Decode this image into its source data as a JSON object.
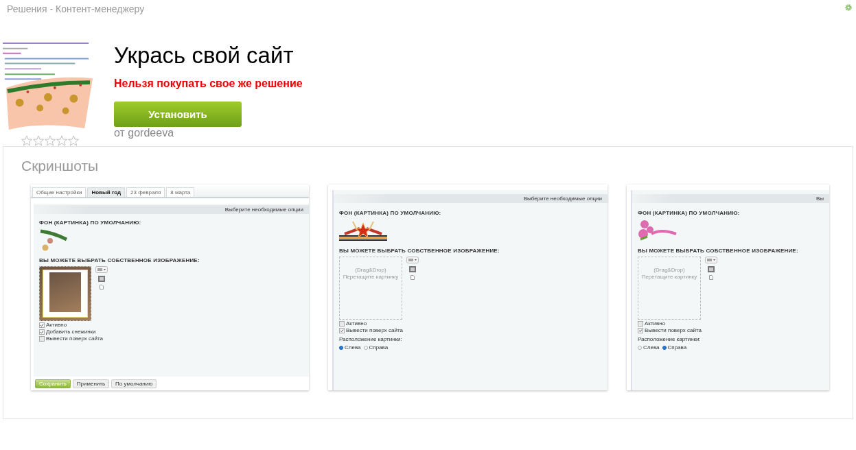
{
  "breadcrumb": "Решения - Контент-менеджеру",
  "app": {
    "title": "Укрась свой сайт",
    "warning": "Нельзя покупать свое же решение",
    "install_button": "Установить",
    "author": "от gordeeva",
    "stars": 0
  },
  "screenshots": {
    "title": "Скриншоты",
    "items": [
      {
        "tabs": [
          {
            "label": "Общие настройки",
            "selected": false
          },
          {
            "label": "Новый год",
            "selected": true
          },
          {
            "label": "23 февраля",
            "selected": false
          },
          {
            "label": "8 марта",
            "selected": false
          }
        ],
        "bar_text": "Выберите необходимые опции",
        "default_label": "ФОН (КАРТИНКА) ПО УМОЛЧАНИЮ:",
        "default_image": {
          "kind": "garland"
        },
        "custom_label": "ВЫ МОЖЕТЕ ВЫБРАТЬ СОБСТВЕННОЕ ИЗОБРАЖЕНИЕ:",
        "dropzone": {
          "kind": "photo"
        },
        "checkboxes": [
          {
            "label": "Активно",
            "checked": true
          },
          {
            "label": "Добавить снежинки",
            "checked": true
          },
          {
            "label": "Вывести поверх сайта",
            "checked": false
          }
        ],
        "buttons": [
          {
            "label": "Сохранить",
            "kind": "primary"
          },
          {
            "label": "Применить",
            "kind": "plain"
          },
          {
            "label": "По умолчанию",
            "kind": "plain"
          }
        ]
      },
      {
        "bar_text": "Выберите необходимые опции",
        "default_label": "ФОН (КАРТИНКА) ПО УМОЛЧАНИЮ:",
        "default_image": {
          "kind": "star"
        },
        "custom_label": "ВЫ МОЖЕТЕ ВЫБРАТЬ СОБСТВЕННОЕ ИЗОБРАЖЕНИЕ:",
        "dropzone": {
          "kind": "empty",
          "hint": [
            "(Drag&Drop)",
            "Перетащите картинку"
          ]
        },
        "checkboxes": [
          {
            "label": "Активно",
            "checked": false
          },
          {
            "label": "Вывести поверх сайта",
            "checked": true
          }
        ],
        "position_label": "Расположение картинки:",
        "radios": [
          {
            "label": "Слева",
            "selected": true
          },
          {
            "label": "Справа",
            "selected": false
          }
        ]
      },
      {
        "bar_text": "Вы",
        "default_label": "ФОН (КАРТИНКА) ПО УМОЛЧАНИЮ:",
        "default_image": {
          "kind": "flowers"
        },
        "custom_label": "ВЫ МОЖЕТЕ ВЫБРАТЬ СОБСТВЕННОЕ ИЗОБРАЖЕНИЕ:",
        "dropzone": {
          "kind": "empty",
          "hint": [
            "(Drag&Drop)",
            "Перетащите картинку"
          ]
        },
        "checkboxes": [
          {
            "label": "Активно",
            "checked": false
          },
          {
            "label": "Вывести поверх сайта",
            "checked": true
          }
        ],
        "position_label": "Расположение картинки:",
        "radios": [
          {
            "label": "Слева",
            "selected": false
          },
          {
            "label": "Справа",
            "selected": true
          }
        ]
      }
    ]
  }
}
